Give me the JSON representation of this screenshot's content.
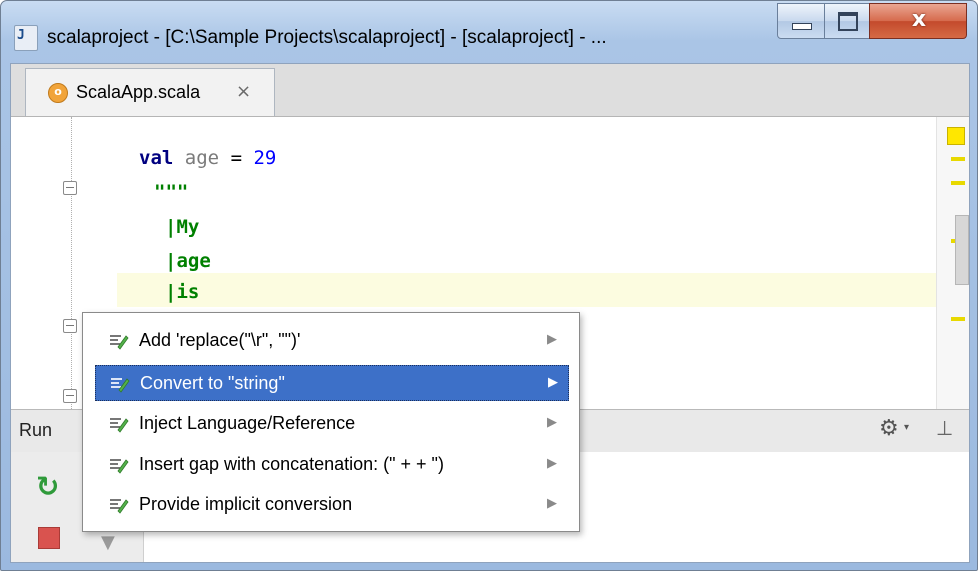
{
  "window": {
    "title": "scalaproject - [C:\\Sample Projects\\scalaproject] - [scalaproject] - ...",
    "app_icon_label": "J"
  },
  "window_controls": {
    "minimize_icon": "minimize-icon",
    "maximize_icon": "maximize-icon",
    "close_glyph": "x"
  },
  "tabs": [
    {
      "icon_text": "o",
      "label": "ScalaApp.scala",
      "close": "×"
    }
  ],
  "editor": {
    "lines": [
      {
        "keyword": "val",
        "name": "age",
        "op": "=",
        "number": "29"
      },
      {
        "string": "\"\"\""
      },
      {
        "string": "|My"
      },
      {
        "string": "|age"
      },
      {
        "string": "|is"
      }
    ]
  },
  "run_panel": {
    "label": "Run",
    "gear_icon": "gear-icon",
    "caret": "▾",
    "pin_glyph": "⊥"
  },
  "popup": {
    "items": [
      {
        "label": "Add 'replace(\"\\r\", \"\")'",
        "selected": false
      },
      {
        "label": "Convert to \"string\"",
        "selected": true
      },
      {
        "label": "Inject Language/Reference",
        "selected": false
      },
      {
        "label": "Insert gap with concatenation: (\" +  + \")",
        "selected": false
      },
      {
        "label": "Provide implicit conversion",
        "selected": false
      }
    ],
    "arrow": "▶"
  },
  "colors": {
    "selection": "#3d70c8",
    "current_line": "#fcfce0",
    "keyword": "#000080",
    "string": "#008000",
    "number": "#0000ff",
    "warning_marker": "#e8d900"
  }
}
